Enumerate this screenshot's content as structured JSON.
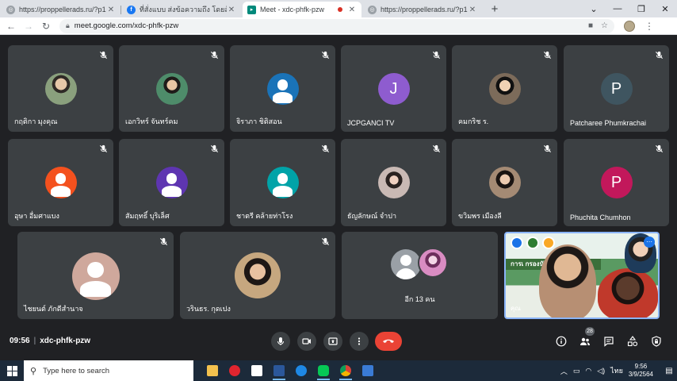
{
  "browser": {
    "tabs": [
      {
        "title": "https://proppellerads.ru/?p101",
        "favicon": "globe-icon",
        "active": false
      },
      {
        "title": "ที่สั่งแบบ ส่งข้อความถึง โดยส้มบ แบบ",
        "favicon": "facebook-icon",
        "active": false
      },
      {
        "title": "Meet - xdc-phfk-pzw",
        "favicon": "meet-icon",
        "active": true
      },
      {
        "title": "https://proppellerads.ru/?p101",
        "favicon": "globe-icon",
        "active": false
      }
    ],
    "new_tab_label": "+",
    "url": "meet.google.com/xdc-phfk-pzw"
  },
  "meet": {
    "participants": [
      {
        "name": "กฤติกา มุงคุณ",
        "avatar_type": "photo"
      },
      {
        "name": "เอกวิทร์ จันทร์คม",
        "avatar_type": "photo"
      },
      {
        "name": "จิราภา ชิติสอน",
        "avatar_type": "generic",
        "color": "#1a73b8"
      },
      {
        "name": "JCPGANCI TV",
        "avatar_type": "letter",
        "letter": "J",
        "color": "#8e5ccf"
      },
      {
        "name": "คมกริช ร.",
        "avatar_type": "photo"
      },
      {
        "name": "Patcharee Phumkrachai",
        "avatar_type": "letter",
        "letter": "P",
        "color": "#3f5560"
      },
      {
        "name": "อุษา อื่มศาแบง",
        "avatar_type": "generic",
        "color": "#f4511e"
      },
      {
        "name": "สัมฤทธิ์ บุริเล็ศ",
        "avatar_type": "generic",
        "color": "#5e35b1"
      },
      {
        "name": "ชาตรี คล้ายท่าโรง",
        "avatar_type": "generic",
        "color": "#00a3a8"
      },
      {
        "name": "ธัญลักษณ์ จำปา",
        "avatar_type": "photo"
      },
      {
        "name": "ขวิมพร เมืองลี",
        "avatar_type": "photo"
      },
      {
        "name": "Phuchita Chumhon",
        "avatar_type": "letter",
        "letter": "P",
        "color": "#c2185b"
      },
      {
        "name": "ไชยนต์ ภักดีสำนาจ",
        "avatar_type": "generic",
        "color": "#cfa89c"
      },
      {
        "name": "วรินธร. กุดเปง",
        "avatar_type": "photo"
      }
    ],
    "others_label": "อีก 13 คน",
    "presenter_banner": "การเ     กรองนักเรีย",
    "presenter_name": "คุณ",
    "meeting_time": "09:56",
    "meeting_code": "xdc-phfk-pzw",
    "participant_count": "28",
    "colors": {
      "accent": "#8ab4f8",
      "hangup": "#ea4335",
      "tile": "#3c4043"
    }
  },
  "taskbar": {
    "search_placeholder": "Type here to search",
    "apps": [
      "file-explorer-icon",
      "opera-icon",
      "notepad-icon",
      "word-icon",
      "edge-icon",
      "line-icon",
      "chrome-icon",
      "photos-icon"
    ],
    "language": "ไทย",
    "time": "9:56",
    "date": "3/9/2564"
  }
}
